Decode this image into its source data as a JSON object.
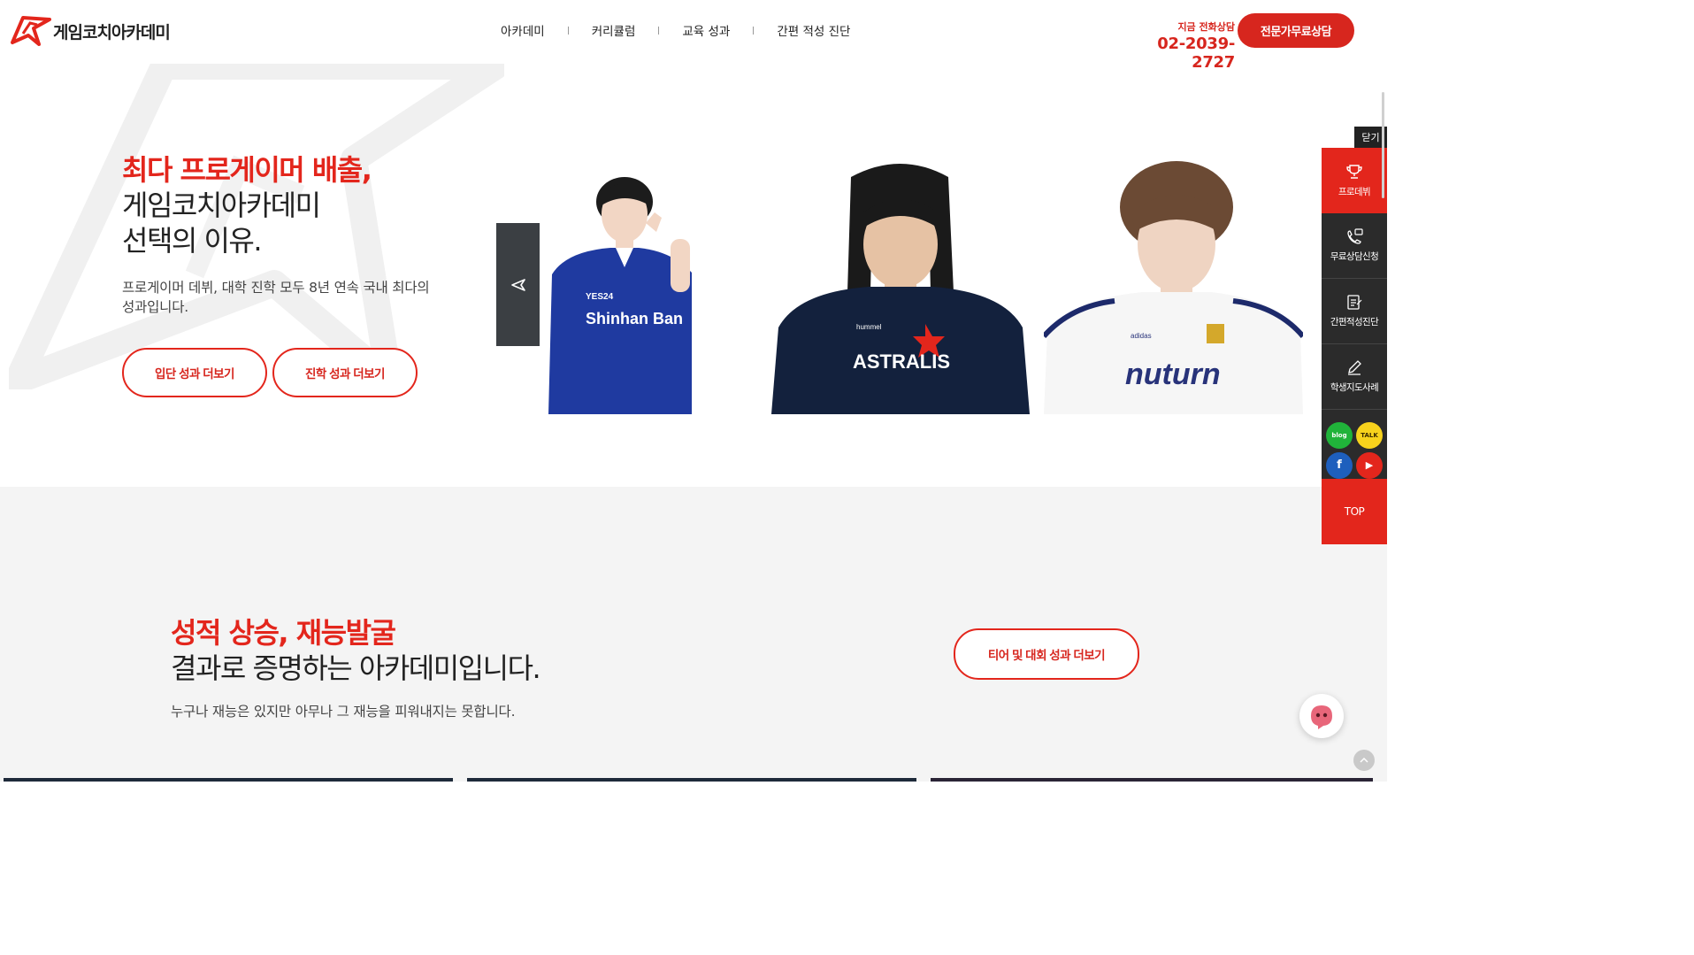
{
  "header": {
    "logo_text": "게임코치아카데미",
    "nav": [
      "아카데미",
      "커리큘럼",
      "교육 성과",
      "간편 적성 진단"
    ],
    "phone_label": "지금 전화상담",
    "phone_number": "02-2039-2727",
    "consult_button": "전문가무료상담"
  },
  "hero": {
    "title_red": "최다 프로게이머 배출,",
    "title_line2": "게임코치아카데미",
    "title_line3": "선택의 이유.",
    "description": "프로게이머 데뷔, 대학 진학 모두 8년 연속 국내 최다의 성과입니다.",
    "buttons": [
      "입단 성과 더보기",
      "진학 성과 더보기"
    ],
    "players": [
      {
        "jersey_text": "Shinhan Ban",
        "sponsor": "YES24"
      },
      {
        "jersey_text": "ASTRALIS",
        "sponsor": "hummel"
      },
      {
        "jersey_text": "nuturn",
        "sponsor": "adidas"
      }
    ]
  },
  "section2": {
    "title_red": "성적 상승, 재능발굴",
    "title_dark": "결과로 증명하는 아카데미입니다.",
    "description": "누구나 재능은 있지만 아무나 그 재능을 피워내지는 못합니다.",
    "button": "티어 및 대회 성과 더보기"
  },
  "quick_menu": {
    "close": "닫기",
    "items": [
      "프로데뷔",
      "무료상담신청",
      "간편적성진단",
      "학생지도사례"
    ],
    "social": [
      "blog",
      "TALK",
      "f",
      "▶"
    ],
    "top": "TOP"
  },
  "colors": {
    "brand_red": "#e3261c",
    "dark_panel": "#2b2b2b"
  }
}
